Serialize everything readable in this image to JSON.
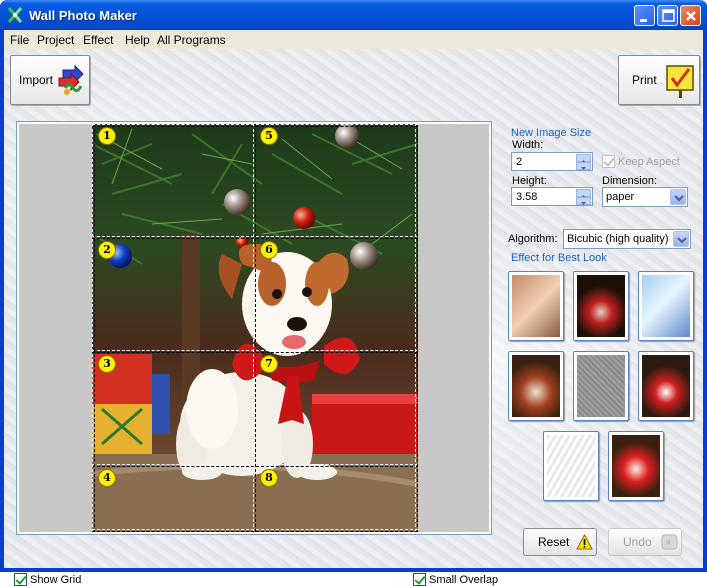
{
  "window": {
    "title": "Wall Photo Maker"
  },
  "menu": [
    "File",
    "Project",
    "Effect",
    "Help",
    "All Programs"
  ],
  "toolbar": {
    "import_label": "Import",
    "print_label": "Print"
  },
  "canvas": {
    "tile_numbers": [
      "1",
      "2",
      "3",
      "4",
      "5",
      "6",
      "7",
      "8"
    ],
    "show_grid_label": "Show Grid",
    "show_grid_checked": true,
    "small_overlap_label": "Small Overlap",
    "small_overlap_checked": true
  },
  "image_size": {
    "group_title": "New Image Size",
    "width_label": "Width:",
    "width_value": "2",
    "keep_aspect_label": "Keep Aspect",
    "keep_aspect_checked": true,
    "keep_aspect_enabled": false,
    "height_label": "Height:",
    "height_value": "3.58",
    "dimension_label": "Dimension:",
    "dimension_value": "paper"
  },
  "algorithm": {
    "label": "Algorithm:",
    "value": "Bicubic (high quality)"
  },
  "effects": {
    "title": "Effect for Best Look"
  },
  "actions": {
    "reset_label": "Reset",
    "undo_label": "Undo",
    "undo_enabled": false
  },
  "colors": {
    "title_bar": "#0453d8",
    "group_title": "#1f5fbf",
    "tile_badge": "#fff200",
    "canvas_bg": "#c8c8c8"
  }
}
